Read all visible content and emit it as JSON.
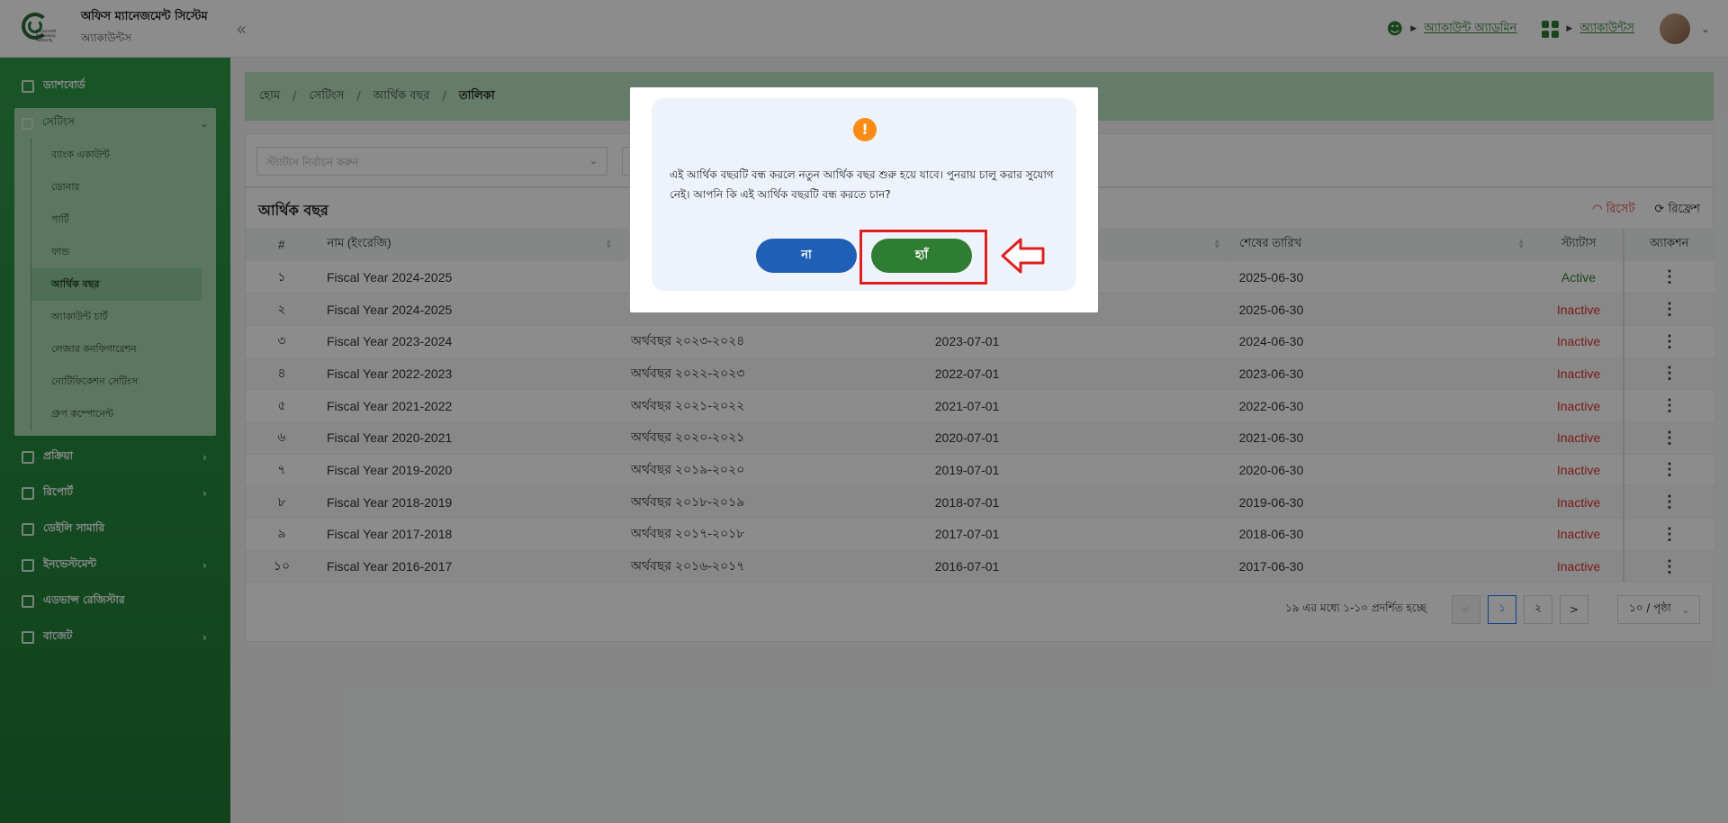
{
  "header": {
    "app_title": "অফিস ম্যানেজমেন্ট সিস্টেম",
    "app_subtitle": "অ্যাকাউন্টস",
    "logo_text": "Microcredit Regulatory Authority",
    "user_role": "অ্যাকাউন্ট অ্যাডমিন",
    "module_link": "অ্যাকাউন্টস"
  },
  "sidebar": {
    "items": [
      {
        "label": "ড্যাশবোর্ড",
        "icon": "dashboard-icon"
      },
      {
        "label": "প্রক্রিয়া",
        "icon": "process-icon"
      },
      {
        "label": "রিপোর্ট",
        "icon": "report-icon"
      },
      {
        "label": "ডেইলি সামারি",
        "icon": "summary-icon"
      },
      {
        "label": "ইনভেস্টমেন্ট",
        "icon": "investment-icon"
      },
      {
        "label": "এডভান্স রেজিস্টার",
        "icon": "register-icon"
      },
      {
        "label": "বাজেট",
        "icon": "budget-icon"
      }
    ],
    "settings": {
      "label": "সেটিংস",
      "children": [
        "ব্যাংক একাউন্ট",
        "ডোনার",
        "পার্টি",
        "ফান্ড",
        "আর্থিক বছর",
        "অ্যাকাউন্ট চার্ট",
        "লেজার কনফিগারেশন",
        "নোটিফিকেশন সেটিংস",
        "গ্রুপ কম্পোনেন্ট"
      ],
      "active_index": 4
    }
  },
  "breadcrumb": {
    "items": [
      "হোম",
      "সেটিংস",
      "আর্থিক বছর",
      "তালিকা"
    ]
  },
  "filters": {
    "status_placeholder": "স্ট্যাটাস নির্বাচন করুন"
  },
  "table": {
    "title": "আর্থিক বছর",
    "reset_label": "রিসেট",
    "refresh_label": "রিফ্রেশ",
    "columns": [
      "#",
      "নাম (ইংরেজি)",
      "",
      "",
      "শেষের তারিখ",
      "স্ট্যাটাস",
      "অ্যাকশন"
    ],
    "rows": [
      {
        "idx": "১",
        "name_en": "Fiscal Year 2024-2025",
        "name_bn": "",
        "start": "",
        "end": "2025-06-30",
        "status": "Active"
      },
      {
        "idx": "২",
        "name_en": "Fiscal Year 2024-2025",
        "name_bn": "",
        "start": "",
        "end": "2025-06-30",
        "status": "Inactive"
      },
      {
        "idx": "৩",
        "name_en": "Fiscal Year 2023-2024",
        "name_bn": "অর্থবছর ২০২৩-২০২৪",
        "start": "2023-07-01",
        "end": "2024-06-30",
        "status": "Inactive"
      },
      {
        "idx": "৪",
        "name_en": "Fiscal Year 2022-2023",
        "name_bn": "অর্থবছর ২০২২-২০২৩",
        "start": "2022-07-01",
        "end": "2023-06-30",
        "status": "Inactive"
      },
      {
        "idx": "৫",
        "name_en": "Fiscal Year 2021-2022",
        "name_bn": "অর্থবছর ২০২১-২০২২",
        "start": "2021-07-01",
        "end": "2022-06-30",
        "status": "Inactive"
      },
      {
        "idx": "৬",
        "name_en": "Fiscal Year 2020-2021",
        "name_bn": "অর্থবছর ২০২০-২০২১",
        "start": "2020-07-01",
        "end": "2021-06-30",
        "status": "Inactive"
      },
      {
        "idx": "৭",
        "name_en": "Fiscal Year 2019-2020",
        "name_bn": "অর্থবছর ২০১৯-২০২০",
        "start": "2019-07-01",
        "end": "2020-06-30",
        "status": "Inactive"
      },
      {
        "idx": "৮",
        "name_en": "Fiscal Year 2018-2019",
        "name_bn": "অর্থবছর ২০১৮-২০১৯",
        "start": "2018-07-01",
        "end": "2019-06-30",
        "status": "Inactive"
      },
      {
        "idx": "৯",
        "name_en": "Fiscal Year 2017-2018",
        "name_bn": "অর্থবছর ২০১৭-২০১৮",
        "start": "2017-07-01",
        "end": "2018-06-30",
        "status": "Inactive"
      },
      {
        "idx": "১০",
        "name_en": "Fiscal Year 2016-2017",
        "name_bn": "অর্থবছর ২০১৬-২০১৭",
        "start": "2016-07-01",
        "end": "2017-06-30",
        "status": "Inactive"
      }
    ]
  },
  "pagination": {
    "info": "১৯ এর মধ্যে ১-১০ প্রদর্শিত হচ্ছে",
    "prev": "<",
    "pages": [
      "১",
      "২"
    ],
    "next": ">",
    "page_size": "১০ / পৃষ্ঠা"
  },
  "modal": {
    "message": "এই আর্থিক বছরটি বন্ধ করলে নতুন আর্থিক বছর শুরু হয়ে যাবে। পুনরায় চালু করার সুযোগ নেই। আপনি কি এই আর্থিক বছরটি বন্ধ করতে চান?",
    "no_label": "না",
    "yes_label": "হ্যাঁ",
    "warn_glyph": "!"
  },
  "colors": {
    "brand_green": "#2e7d32",
    "danger_red": "#e03131",
    "no_button_blue": "#1f5fb5",
    "warning_orange": "#fa8c16"
  }
}
